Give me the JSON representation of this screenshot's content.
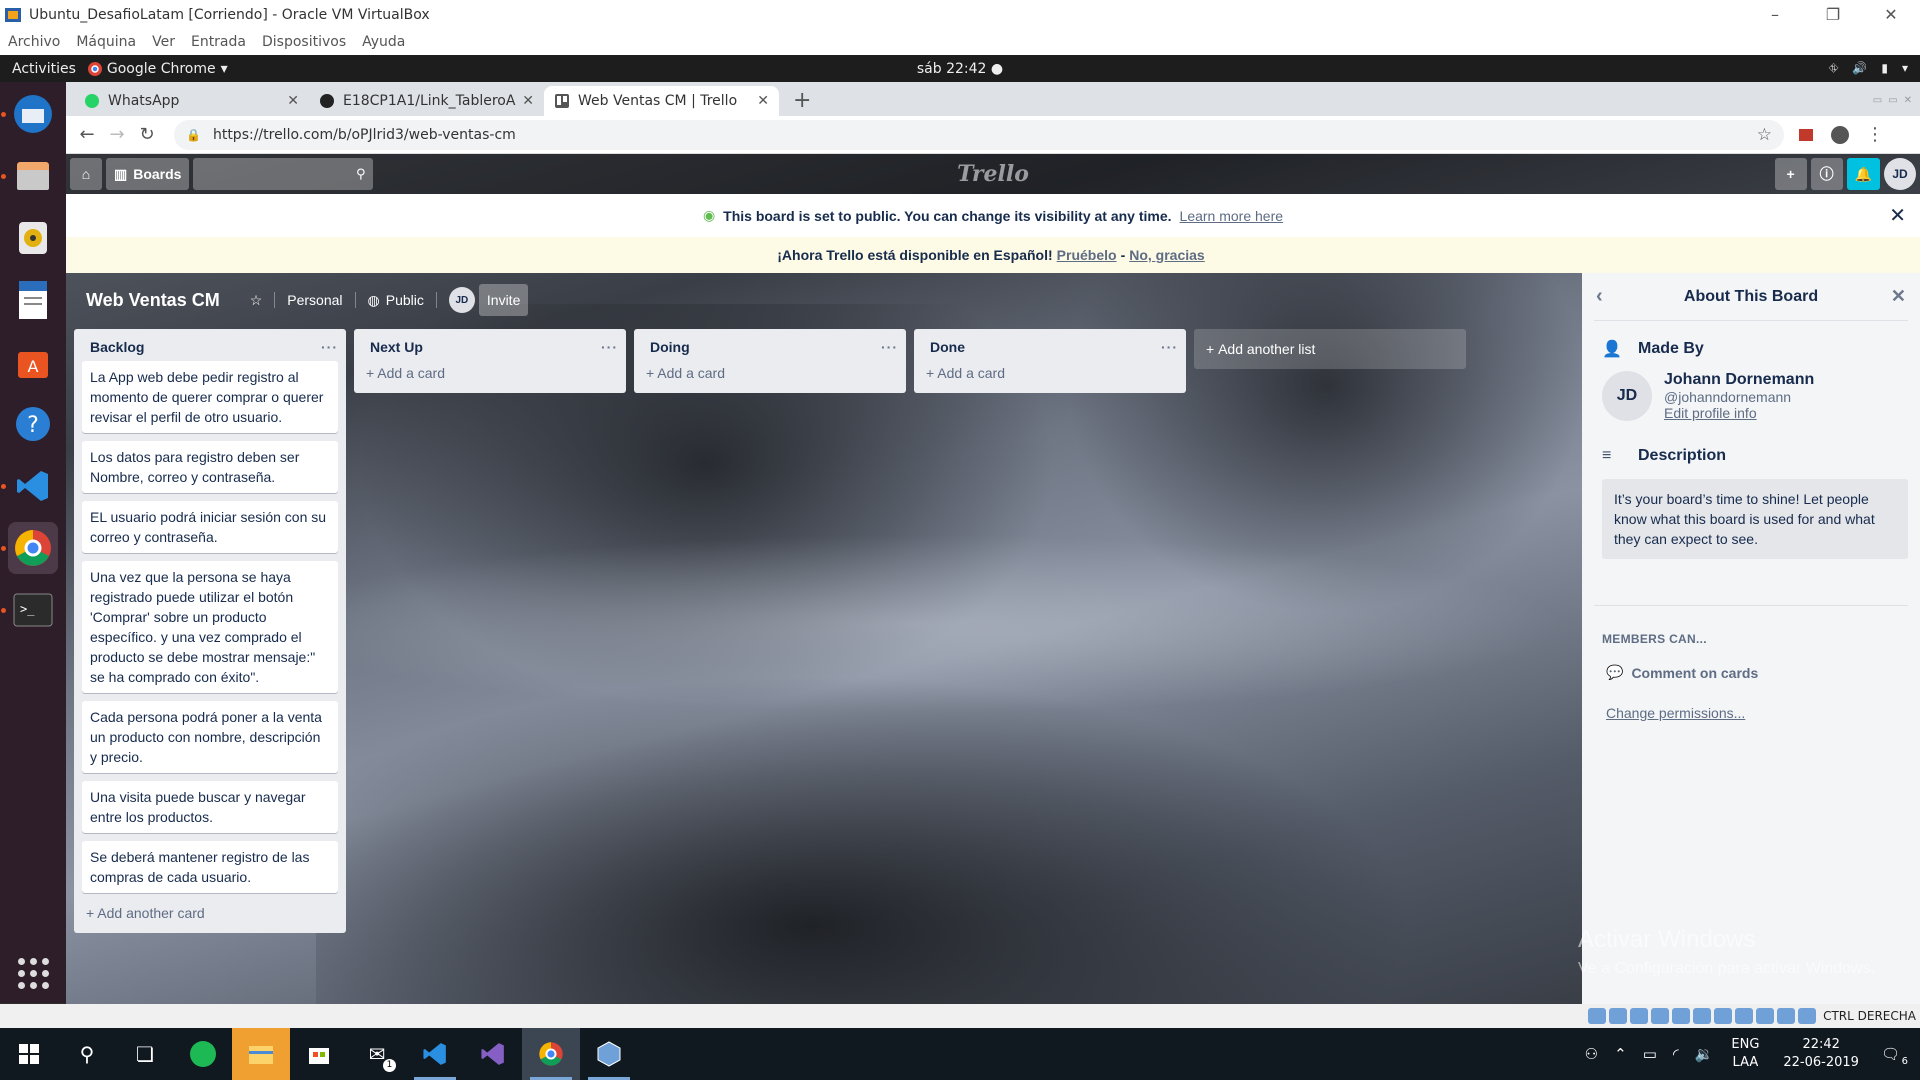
{
  "vbox": {
    "title": "Ubuntu_DesafioLatam [Corriendo] - Oracle VM VirtualBox",
    "menu": [
      "Archivo",
      "Máquina",
      "Ver",
      "Entrada",
      "Dispositivos",
      "Ayuda"
    ],
    "status_text": "CTRL DERECHA"
  },
  "ubuntu": {
    "activities": "Activities",
    "app_name": "Google Chrome",
    "clock": "sáb 22:42"
  },
  "chrome": {
    "tabs": [
      {
        "label": "WhatsApp",
        "icon": "whatsapp-icon",
        "active": false
      },
      {
        "label": "E18CP1A1/Link_TableroA",
        "icon": "github-icon",
        "active": false
      },
      {
        "label": "Web Ventas CM | Trello",
        "icon": "trello-icon",
        "active": true
      }
    ],
    "url": "https://trello.com/b/oPJlrid3/web-ventas-cm"
  },
  "trello": {
    "header": {
      "boards_label": "Boards",
      "logo": "Trello",
      "avatar_initials": "JD"
    },
    "public_banner": {
      "text": "This board is set to public. You can change its visibility at any time.",
      "link": "Learn more here"
    },
    "spanish_banner": {
      "text": "¡Ahora Trello está disponible en Español!",
      "try_link": "Pruébelo",
      "separator": "-",
      "no_link": "No, gracias"
    },
    "board": {
      "name": "Web Ventas CM",
      "team": "Personal",
      "visibility": "Public",
      "member_initials": "JD",
      "invite": "Invite"
    },
    "lists": [
      {
        "title": "Backlog",
        "cards": [
          "La App web debe pedir registro al momento de querer comprar o querer revisar el perfil de otro usuario.",
          "Los datos para registro deben ser Nombre, correo y contraseña.",
          "EL usuario podrá iniciar sesión con su correo y contraseña.",
          "Una vez que la persona se haya registrado puede utilizar el botón 'Comprar' sobre un producto específico. y una vez comprado el producto se debe mostrar mensaje:\" se ha comprado con éxito\".",
          "Cada persona podrá poner a la venta un producto con nombre, descripción y precio.",
          "Una visita puede buscar y navegar entre los productos.",
          "Se deberá mantener registro de las compras de cada usuario."
        ],
        "add_label": "Add another card"
      },
      {
        "title": "Next Up",
        "cards": [],
        "add_label": "Add a card"
      },
      {
        "title": "Doing",
        "cards": [],
        "add_label": "Add a card"
      },
      {
        "title": "Done",
        "cards": [],
        "add_label": "Add a card"
      }
    ],
    "add_list_label": "Add another list",
    "sidebar": {
      "title": "About This Board",
      "made_by_label": "Made By",
      "member_initials": "JD",
      "member_name": "Johann Dornemann",
      "member_username": "@johanndornemann",
      "edit_profile": "Edit profile info",
      "description_label": "Description",
      "description_text": "It’s your board’s time to shine! Let people know what this board is used for and what they can expect to see.",
      "members_can": "MEMBERS CAN...",
      "permission": "Comment on cards",
      "change_permissions": "Change permissions..."
    }
  },
  "watermark": {
    "line1": "Activar Windows",
    "line2": "Ve a Configuración para activar Windows."
  },
  "windows_taskbar": {
    "lang_top": "ENG",
    "lang_bottom": "LAA",
    "time": "22:42",
    "date": "22-06-2019",
    "mail_badge": "1",
    "notification_count": "6"
  },
  "colors": {
    "trello_blue": "#0079bf",
    "list_bg": "#ebecf0",
    "banner_yellow": "#fdfae5",
    "ubuntu_orange": "#e95420"
  }
}
